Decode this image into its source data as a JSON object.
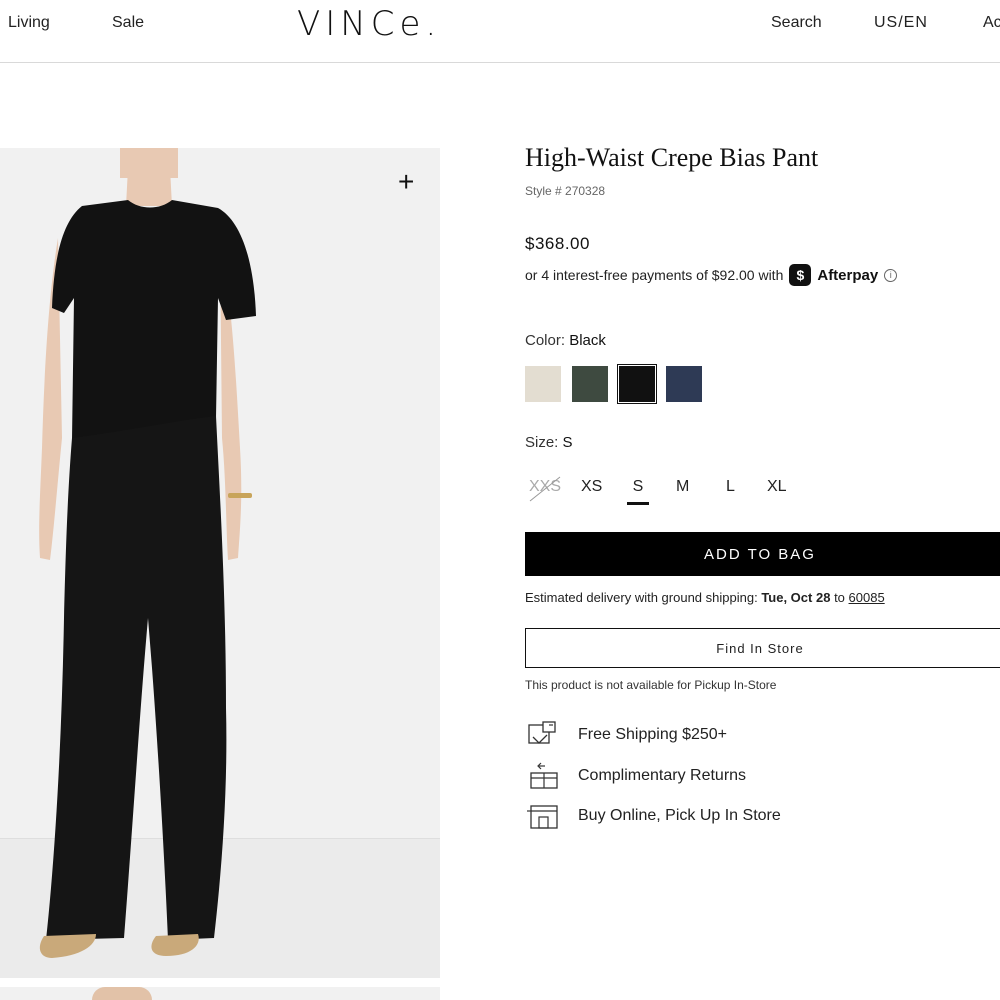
{
  "header": {
    "nav_left": [
      "Living",
      "Sale"
    ],
    "logo": "VINCe.",
    "search": "Search",
    "locale": "US/EN",
    "account": "Ac"
  },
  "gallery": {
    "zoom_icon": "plus-icon"
  },
  "product": {
    "title": "High-Waist Crepe Bias Pant",
    "style": "Style # 270328",
    "price": "$368.00",
    "afterpay_text": "or 4 interest-free payments of $92.00 with",
    "afterpay_badge": "$",
    "afterpay_brand": "Afterpay",
    "afterpay_info": "i",
    "color_label": "Color:",
    "color_value": "Black",
    "swatches": [
      {
        "name": "cream",
        "hex": "#e3ddd1"
      },
      {
        "name": "dark green",
        "hex": "#3e4a40"
      },
      {
        "name": "black",
        "hex": "#111111",
        "selected": true
      },
      {
        "name": "navy",
        "hex": "#2e3a55"
      }
    ],
    "size_label": "Size:",
    "size_value": "S",
    "sizes": [
      {
        "label": "XXS",
        "available": false
      },
      {
        "label": "XS",
        "available": true
      },
      {
        "label": "S",
        "available": true,
        "selected": true
      },
      {
        "label": "M",
        "available": true
      },
      {
        "label": "L",
        "available": true
      },
      {
        "label": "XL",
        "available": true
      }
    ],
    "add_to_bag": "ADD TO BAG",
    "delivery_prefix": "Estimated delivery with ground shipping:",
    "delivery_date": "Tue, Oct 28",
    "delivery_to": "to",
    "delivery_zip": "60085",
    "find_in_store": "Find In Store",
    "pickup_note": "This product is not available for Pickup In-Store",
    "perks": [
      {
        "icon": "shipping-box-icon",
        "label": "Free Shipping $250+"
      },
      {
        "icon": "return-box-icon",
        "label": "Complimentary Returns"
      },
      {
        "icon": "store-icon",
        "label": "Buy Online, Pick Up In Store"
      }
    ]
  }
}
